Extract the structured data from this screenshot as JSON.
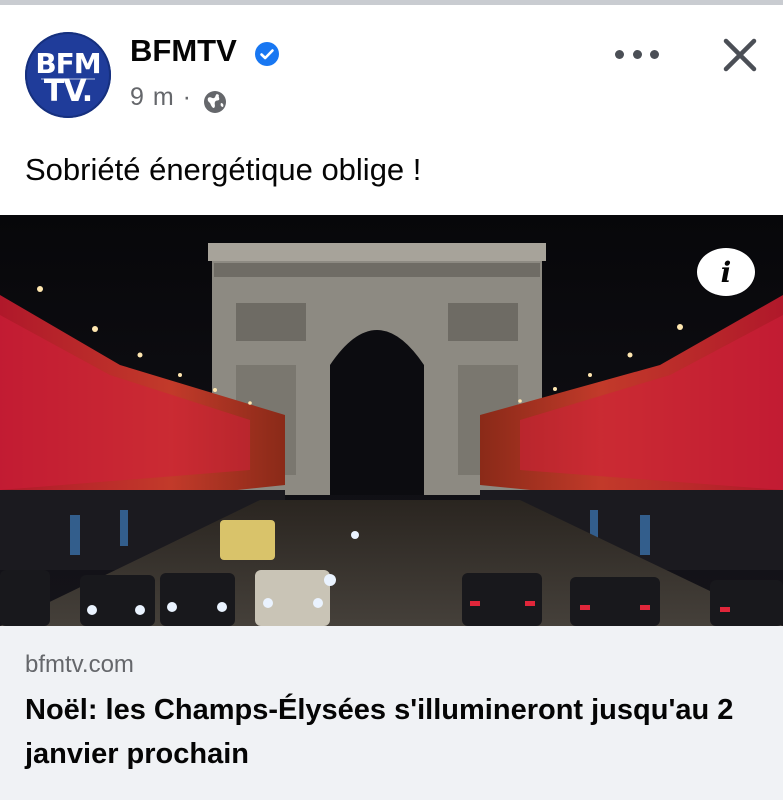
{
  "post": {
    "page_name": "BFMTV",
    "avatar_line1": "BFM",
    "avatar_line2": "TV.",
    "time_ago": "9 m ·",
    "text": "Sobriété énergétique oblige !"
  },
  "link_preview": {
    "domain": "bfmtv.com",
    "title": "Noël: les Champs-Élysées s'illumineront jusqu'au 2 janvier prochain"
  },
  "icons": {
    "verified": "verified-badge-icon",
    "privacy": "globe-icon",
    "more": "more-options-icon",
    "close": "close-icon",
    "info": "info-icon"
  },
  "colors": {
    "verified_blue": "#1877f2",
    "avatar_blue": "#1f3c9a",
    "secondary_text": "#65676b",
    "preview_bg": "#f0f2f5"
  }
}
